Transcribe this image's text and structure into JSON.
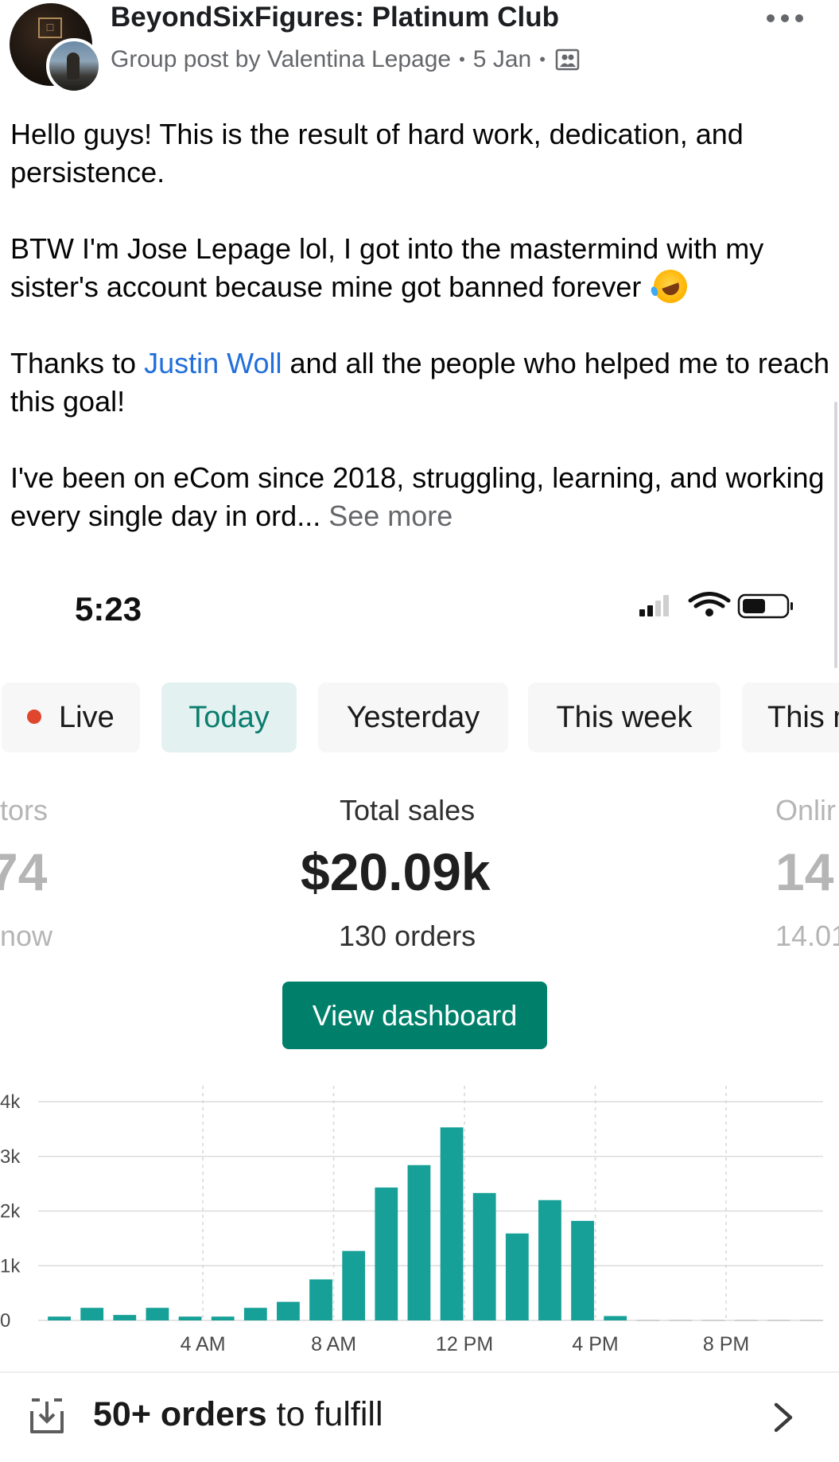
{
  "post": {
    "group_name": "BeyondSixFigures: Platinum Club",
    "meta_author": "Group post by Valentina Lepage",
    "meta_date": "5 Jan",
    "meta_separator": "•",
    "paragraphs": {
      "p1": "Hello guys! This is the result of hard work, dedication, and persistence.",
      "p2": "BTW I'm Jose Lepage lol, I got into the mastermind with my sister's account because mine got banned forever",
      "p3_before": "Thanks to ",
      "p3_link": "Justin Woll",
      "p3_after": " and all the people who helped me to reach this goal!",
      "p4": "I've been on eCom since 2018, struggling, learning, and working every single day in ord...",
      "see_more": "See more"
    },
    "icons": {
      "audience": "group-audience-icon",
      "more": "more-options-icon",
      "emoji": "rolling-on-floor-laughing-emoji"
    }
  },
  "phone": {
    "status_time": "5:23",
    "tabs": {
      "live": "Live",
      "today": "Today",
      "yesterday": "Yesterday",
      "this_week": "This week",
      "this_month_partial": "This m"
    },
    "stats": {
      "left_label": "tors",
      "left_value": "74",
      "left_sub": "now",
      "center_label": "Total sales",
      "center_value": "$20.09k",
      "center_sub": "130 orders",
      "right_label": "Onlir",
      "right_value": "14",
      "right_sub": "14.01"
    },
    "view_dashboard": "View dashboard",
    "fulfill_count": "50+ orders",
    "fulfill_rest": " to fulfill",
    "colors": {
      "accent": "#00806a",
      "bar": "#17a097",
      "live_dot": "#e0462e",
      "link": "#216fdb"
    }
  },
  "chart_data": {
    "type": "bar",
    "categories": [
      "12 AM",
      "1 AM",
      "2 AM",
      "3 AM",
      "4 AM",
      "5 AM",
      "6 AM",
      "7 AM",
      "8 AM",
      "9 AM",
      "10 AM",
      "11 AM",
      "12 PM",
      "1 PM",
      "2 PM",
      "3 PM",
      "4 PM",
      "5 PM",
      "6 PM",
      "7 PM",
      "8 PM",
      "9 PM",
      "10 PM",
      "11 PM"
    ],
    "values": [
      70,
      230,
      100,
      230,
      70,
      70,
      230,
      340,
      750,
      1270,
      2430,
      2840,
      3530,
      2330,
      1590,
      2200,
      1820,
      80,
      0,
      0,
      0,
      0,
      0,
      0
    ],
    "ylim": [
      0,
      4000
    ],
    "y_ticks": [
      "0",
      "1k",
      "2k",
      "3k",
      "4k"
    ],
    "x_ticks": [
      "4 AM",
      "8 AM",
      "12 PM",
      "4 PM",
      "8 PM"
    ],
    "grid": true
  }
}
